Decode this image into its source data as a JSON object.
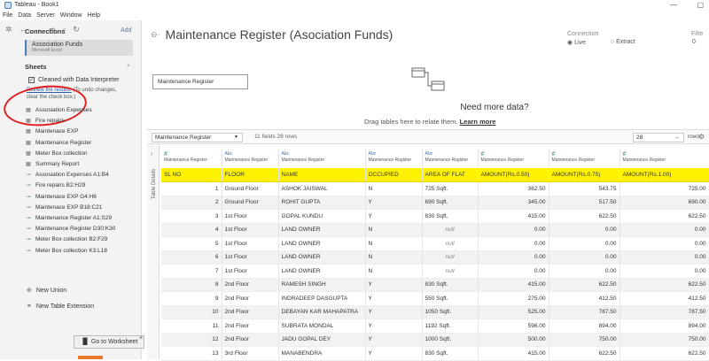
{
  "window": {
    "title": "Tableau - Book1"
  },
  "menu": [
    "File",
    "Data",
    "Server",
    "Window",
    "Help"
  ],
  "toolbar": {
    "icons": [
      "tableau-logo-icon",
      "back-icon",
      "forward-icon",
      "redo-icon",
      "save-icon",
      "refresh-icon"
    ]
  },
  "connections": {
    "heading": "Connections",
    "add_label": "Add",
    "items": [
      {
        "name": "Association Funds",
        "type": "Microsoft Excel"
      }
    ]
  },
  "sheets": {
    "heading": "Sheets",
    "cleaned_label": "Cleaned with Data Interpreter",
    "review_link": "Review the results.",
    "review_text": "(To undo changes, clear the check box.)",
    "items": [
      {
        "name": "Assosiation Expenses",
        "kind": "sheet"
      },
      {
        "name": "Fire repairs",
        "kind": "sheet"
      },
      {
        "name": "Maintenace EXP",
        "kind": "sheet"
      },
      {
        "name": "Maintenance Register",
        "kind": "sheet"
      },
      {
        "name": "Meter Box collection",
        "kind": "sheet"
      },
      {
        "name": "Summary Report",
        "kind": "sheet"
      },
      {
        "name": "Assosiation Expenses A1:B4",
        "kind": "range"
      },
      {
        "name": "Fire repairs B2:H29",
        "kind": "range"
      },
      {
        "name": "Maintenace EXP G4:H6",
        "kind": "range"
      },
      {
        "name": "Maintenace EXP B18:C21",
        "kind": "range"
      },
      {
        "name": "Maintenance Register A1:S29",
        "kind": "range"
      },
      {
        "name": "Maintenance Register D30:K30",
        "kind": "range"
      },
      {
        "name": "Meter Box collection B2:F29",
        "kind": "range"
      },
      {
        "name": "Meter Box collection K3:L18",
        "kind": "range"
      }
    ],
    "new_union": "New Union",
    "new_extension": "New Table Extension"
  },
  "goto_worksheet": "Go to Worksheet",
  "datasource": {
    "title": "Maintenance Register (Asociation Funds)",
    "connection_label": "Connection",
    "live": "Live",
    "extract": "Extract",
    "filters_label": "Filte",
    "filters_count": "0"
  },
  "canvas": {
    "table_name": "Maintenance Register",
    "need_more": "Need more data?",
    "drag_text": "Drag tables here to relate them.",
    "learn_more": "Learn more"
  },
  "grid": {
    "selected_table": "Maintenance Register",
    "meta": "11 fields 28 rows",
    "rows_value": "28",
    "rows_label": "rows",
    "details_label": "Table Details",
    "source_label": "Maintenance Register",
    "columns": [
      {
        "type": "#",
        "name": "SL NO"
      },
      {
        "type": "Abc",
        "name": "FLOOR"
      },
      {
        "type": "Abc",
        "name": "NAME"
      },
      {
        "type": "Abc",
        "name": "OCCUPIED"
      },
      {
        "type": "Abc",
        "name": "AREA OF FLAT"
      },
      {
        "type": "#",
        "name": "AMOUNT(Rs.0.50)"
      },
      {
        "type": "#",
        "name": "AMOUNT(Rs.0.75)"
      },
      {
        "type": "#",
        "name": "AMOUNT(Rs.1.00)"
      }
    ],
    "rows": [
      [
        "1",
        "Ground Floor",
        "ASHOK JAISWAL",
        "N",
        "725 Sqft.",
        "362.50",
        "543.75",
        "725.00"
      ],
      [
        "2",
        "Ground Floor",
        "ROHIT GUPTA",
        "Y",
        "690 Sqft.",
        "345.00",
        "517.50",
        "690.00"
      ],
      [
        "3",
        "1st Floor",
        "GOPAL KUNDU",
        "Y",
        "830 Sqft.",
        "415.00",
        "622.50",
        "622.50"
      ],
      [
        "4",
        "1st Floor",
        "LAND OWNER",
        "N",
        "null",
        "0.00",
        "0.00",
        "0.00"
      ],
      [
        "5",
        "1st Floor",
        "LAND OWNER",
        "N",
        "null",
        "0.00",
        "0.00",
        "0.00"
      ],
      [
        "6",
        "1st Floor",
        "LAND OWNER",
        "N",
        "null",
        "0.00",
        "0.00",
        "0.00"
      ],
      [
        "7",
        "1st Floor",
        "LAND OWNER",
        "N",
        "null",
        "0.00",
        "0.00",
        "0.00"
      ],
      [
        "8",
        "2nd Floor",
        "RAMESH SINGH",
        "Y",
        "830 Sqft.",
        "415.00",
        "622.50",
        "622.50"
      ],
      [
        "9",
        "2nd Floor",
        "INDRADEEP DASGUPTA",
        "Y",
        "550 Sqft.",
        "275.00",
        "412.50",
        "412.50"
      ],
      [
        "10",
        "2nd Floor",
        "DEBAYAN KAR MAHAPATRA",
        "Y",
        "1050 Sqft.",
        "525.00",
        "787.50",
        "787.50"
      ],
      [
        "11",
        "2nd Floor",
        "SUBRATA MONDAL",
        "Y",
        "1192 Sqft.",
        "596.00",
        "894.00",
        "894.00"
      ],
      [
        "12",
        "2nd Floor",
        "JADU GOPAL DEY",
        "Y",
        "1000 Sqft.",
        "500.00",
        "750.00",
        "750.00"
      ],
      [
        "13",
        "3rd Floor",
        "MANABENDRA",
        "Y",
        "830 Sqft.",
        "415.00",
        "622.50",
        "622.50"
      ]
    ]
  },
  "colors": {
    "highlight": "#fff200",
    "annotation": "#e02020",
    "accent": "#e8782a"
  }
}
